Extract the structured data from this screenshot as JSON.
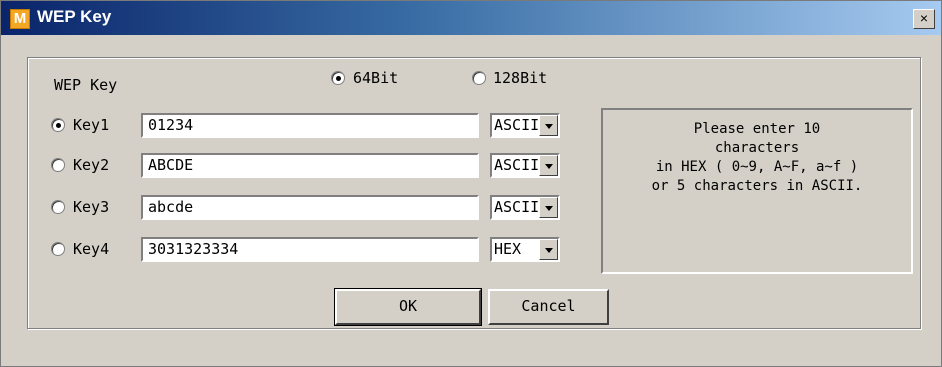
{
  "window": {
    "title": "WEP Key",
    "app_icon_letter": "M",
    "close_label": "×"
  },
  "dialog": {
    "section_label": "WEP Key",
    "bit_options": [
      {
        "label": "64Bit",
        "selected": true
      },
      {
        "label": "128Bit",
        "selected": false
      }
    ],
    "keys": [
      {
        "label": "Key1",
        "selected": true,
        "value": "01234",
        "format": "ASCII"
      },
      {
        "label": "Key2",
        "selected": false,
        "value": "ABCDE",
        "format": "ASCII"
      },
      {
        "label": "Key3",
        "selected": false,
        "value": "abcde",
        "format": "ASCII"
      },
      {
        "label": "Key4",
        "selected": false,
        "value": "3031323334",
        "format": "HEX"
      }
    ],
    "info_lines": [
      "Please enter 10",
      "characters",
      "in HEX ( 0~9, A~F, a~f )",
      "or 5 characters in ASCII."
    ],
    "ok_label": "OK",
    "cancel_label": "Cancel"
  }
}
